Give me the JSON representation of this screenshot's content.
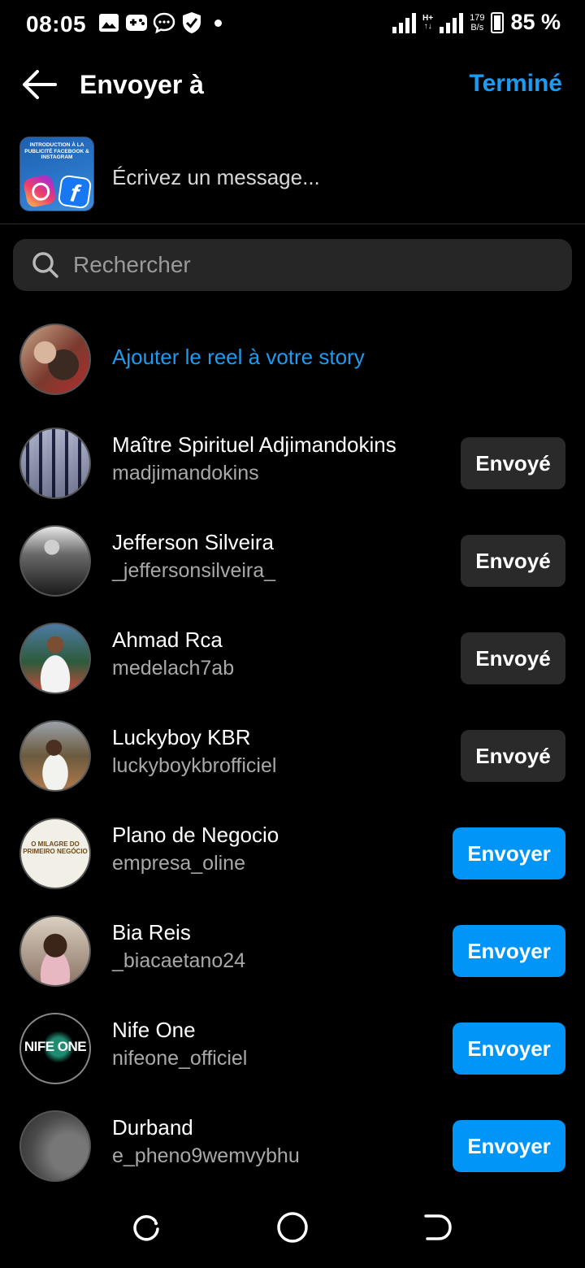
{
  "status_bar": {
    "time": "08:05",
    "network_tag_top": "H+",
    "network_tag_bottom": "↑↓",
    "speed_value": "179",
    "speed_unit": "B/s",
    "battery": "85 %"
  },
  "header": {
    "title": "Envoyer à",
    "done_label": "Terminé"
  },
  "composer": {
    "placeholder": "Écrivez un message...",
    "thumbnail_text": "INTRODUCTION À LA PUBLICITÉ FACEBOOK & INSTAGRAM",
    "thumbnail_fb_letter": "f"
  },
  "search": {
    "placeholder": "Rechercher"
  },
  "story_option": {
    "label": "Ajouter le reel à votre story"
  },
  "contacts": [
    {
      "name": "Maître Spirituel Adjimandokins",
      "handle": "madjimandokins",
      "button": "Envoyé",
      "state": "sent"
    },
    {
      "name": "Jefferson Silveira",
      "handle": "_jeffersonsilveira_",
      "button": "Envoyé",
      "state": "sent"
    },
    {
      "name": "Ahmad Rca",
      "handle": "medelach7ab",
      "button": "Envoyé",
      "state": "sent"
    },
    {
      "name": "Luckyboy KBR",
      "handle": "luckyboykbrofficiel",
      "button": "Envoyé",
      "state": "sent"
    },
    {
      "name": "Plano de Negocio",
      "handle": "empresa_oline",
      "button": "Envoyer",
      "state": "send",
      "avatar_text": "O MILAGRE DO PRIMEIRO NEGÓCIO"
    },
    {
      "name": "Bia Reis",
      "handle": "_biacaetano24",
      "button": "Envoyer",
      "state": "send"
    },
    {
      "name": "Nife One",
      "handle": "nifeone_officiel",
      "button": "Envoyer",
      "state": "send",
      "avatar_text": "NIFE ONE"
    },
    {
      "name": "Durband",
      "handle": "e_pheno9wemvybhu",
      "button": "Envoyer",
      "state": "send"
    }
  ],
  "colors": {
    "accent": "#1d9bf0",
    "send_button": "#0095f6",
    "sent_button": "#2a2a2a",
    "background": "#000000"
  },
  "icons": {
    "back": "arrow-left-icon",
    "search": "search-icon",
    "nav_recent": "recent-apps-icon",
    "nav_home": "home-circle-icon",
    "nav_back": "back-nav-icon"
  }
}
